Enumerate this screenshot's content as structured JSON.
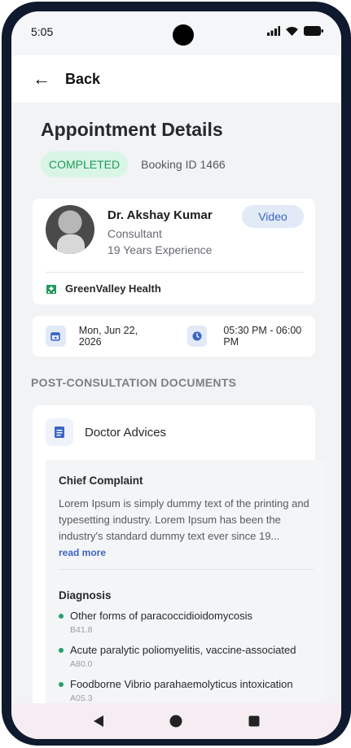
{
  "status_bar": {
    "time": "5:05"
  },
  "app_bar": {
    "back_label": "Back"
  },
  "header": {
    "title": "Appointment Details",
    "status_badge": "COMPLETED",
    "booking_id": "Booking ID 1466"
  },
  "doctor": {
    "name": "Dr. Akshay Kumar",
    "role": "Consultant",
    "experience": "19 Years Experience",
    "consult_type": "Video",
    "clinic": "GreenValley Health"
  },
  "schedule": {
    "date": "Mon, Jun 22, 2026",
    "time": "05:30 PM - 06:00 PM"
  },
  "documents": {
    "section_label": "POST-CONSULTATION DOCUMENTS",
    "card_title": "Doctor Advices",
    "chief_complaint": {
      "title": "Chief Complaint",
      "text": "Lorem Ipsum is simply dummy text of the printing and typesetting industry. Lorem Ipsum has been the industry's standard dummy text ever since 19...",
      "read_more": "read more"
    },
    "diagnosis": {
      "title": "Diagnosis",
      "items": [
        {
          "name": "Other forms of paracoccidioidomycosis",
          "code": "B41.8"
        },
        {
          "name": "Acute paralytic poliomyelitis, vaccine-associated",
          "code": "A80.0"
        },
        {
          "name": "Foodborne Vibrio parahaemolyticus intoxication",
          "code": "A05.3"
        }
      ]
    }
  },
  "colors": {
    "accent": "#3c64c4",
    "success": "#1f9a5b",
    "badge_bg": "#d9f5e6"
  }
}
